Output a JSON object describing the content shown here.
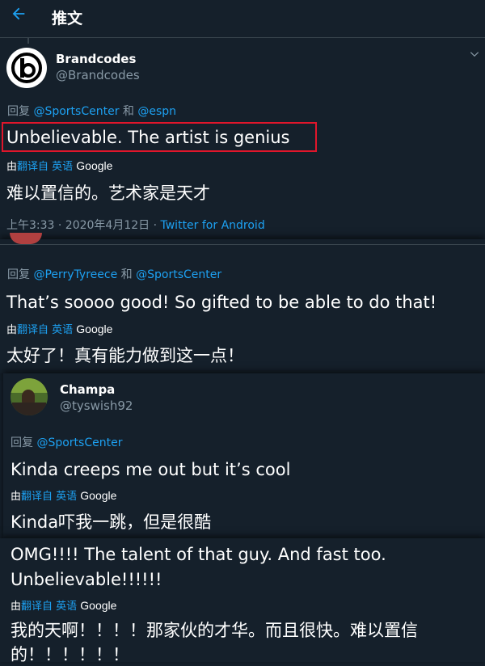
{
  "header": {
    "title": "推文"
  },
  "tweets": [
    {
      "name": "Brandcodes",
      "handle": "@Brandcodes",
      "reply_prefix": "回复",
      "reply_to_1": "@SportsCenter",
      "reply_and": "和",
      "reply_to_2": "@espn",
      "text_en": "Unbelievable. The artist is genius",
      "translated_prefix": "由",
      "translated_link": "翻译自 英语",
      "translated_google": "Google",
      "text_zh": "难以置信的。艺术家是天才",
      "timestamp": "上午3:33 · 2020年4月12日 · ",
      "source": "Twitter for Android"
    },
    {
      "reply_prefix": "回复",
      "reply_to_1": "@PerryTyreece",
      "reply_and": "和",
      "reply_to_2": "@SportsCenter",
      "text_en": "That’s soooo good! So gifted to be able to do that!",
      "translated_prefix": "由",
      "translated_link": "翻译自 英语",
      "translated_google": "Google",
      "text_zh": "太好了！真有能力做到这一点！"
    },
    {
      "name": "Champa",
      "handle": "@tyswish92",
      "reply_prefix": "回复",
      "reply_to_1": "@SportsCenter",
      "text_en": "Kinda creeps me out but it’s cool",
      "translated_prefix": "由",
      "translated_link": "翻译自 英语",
      "translated_google": "Google",
      "text_zh": "Kinda吓我一跳，但是很酷"
    },
    {
      "text_en_line1": "OMG!!!! The talent of that guy. And fast too.",
      "text_en_line2": "Unbelievable!!!!!!",
      "translated_prefix": "由",
      "translated_link": "翻译自 英语",
      "translated_google": "Google",
      "text_zh_line1": "我的天啊！！！！那家伙的才华。而且很快。难以置信",
      "text_zh_line2": "的！！！！！！"
    }
  ],
  "icons": {
    "back": "back-arrow-icon",
    "caret": "chevron-down-icon",
    "logo": "brandcodes-logo"
  },
  "colors": {
    "background": "#15202b",
    "accent": "#1da1f2",
    "muted": "#8899a6",
    "highlight": "#e0162b"
  }
}
